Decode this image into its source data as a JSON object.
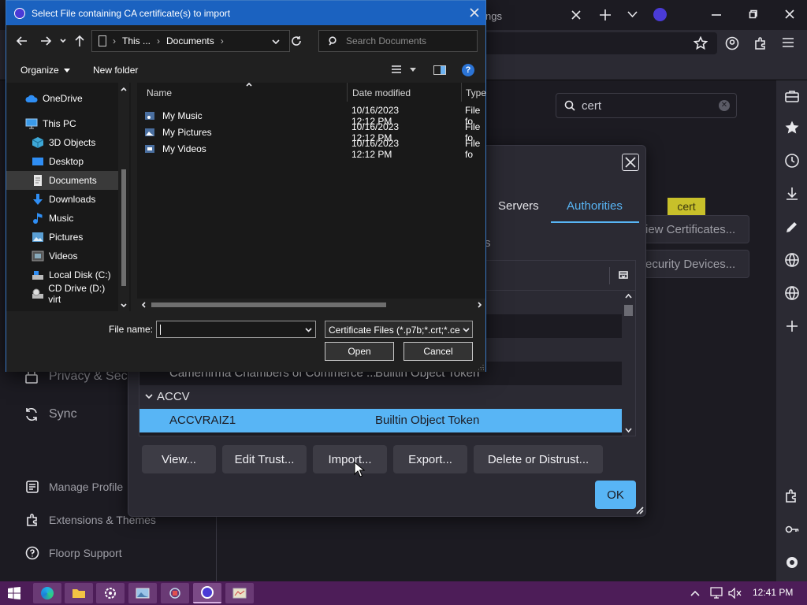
{
  "browser": {
    "tab_fragment": "ngs",
    "settings_nav": [
      {
        "label": "Privacy & Secu",
        "icon": "lock-icon"
      },
      {
        "label": "Sync",
        "icon": "sync-icon"
      }
    ],
    "settings_footer": [
      {
        "label": "Manage Profile",
        "icon": "profile-icon"
      },
      {
        "label": "Extensions & Themes",
        "icon": "puzzle-icon"
      },
      {
        "label": "Floorp Support",
        "icon": "help-icon"
      }
    ],
    "search_value": "cert",
    "highlight_tooltip": "cert",
    "view_certificates_button": "View Certificates...",
    "view_certificates_visible": "iew Certificates...",
    "security_devices_visible": "ecurity Devices..."
  },
  "cert_manager": {
    "tabs": [
      "Servers",
      "Authorities"
    ],
    "active_tab": "Authorities",
    "label_fragment": "s",
    "rows": [
      {
        "type": "item",
        "name": "Camerfirma Chambers of Commerce ...",
        "token": "Builtin Object Token"
      },
      {
        "type": "group",
        "name": "ACCV"
      },
      {
        "type": "item",
        "name": "ACCVRAIZ1",
        "token": "Builtin Object Token",
        "selected": true
      }
    ],
    "buttons": [
      "View...",
      "Edit Trust...",
      "Import...",
      "Export...",
      "Delete or Distrust..."
    ],
    "ok_label": "OK"
  },
  "file_dialog": {
    "title": "Select File containing CA certificate(s) to import",
    "address": {
      "segments": [
        "This ...",
        "Documents"
      ]
    },
    "search_placeholder": "Search Documents",
    "toolbar": {
      "organize": "Organize",
      "new_folder": "New folder"
    },
    "nav_items": [
      {
        "label": "OneDrive",
        "icon": "cloud-icon",
        "indent": 1
      },
      {
        "label": "This PC",
        "icon": "computer-icon",
        "indent": 1
      },
      {
        "label": "3D Objects",
        "icon": "cube-icon",
        "indent": 2
      },
      {
        "label": "Desktop",
        "icon": "desktop-folder-icon",
        "indent": 2
      },
      {
        "label": "Documents",
        "icon": "documents-icon",
        "indent": 2,
        "selected": true
      },
      {
        "label": "Downloads",
        "icon": "download-arrow-icon",
        "indent": 2
      },
      {
        "label": "Music",
        "icon": "music-note-icon",
        "indent": 2
      },
      {
        "label": "Pictures",
        "icon": "pictures-icon",
        "indent": 2
      },
      {
        "label": "Videos",
        "icon": "video-icon",
        "indent": 2
      },
      {
        "label": "Local Disk (C:)",
        "icon": "drive-icon",
        "indent": 2
      },
      {
        "label": "CD Drive (D:) virt",
        "icon": "cd-drive-icon",
        "indent": 2
      }
    ],
    "columns": {
      "name": "Name",
      "date": "Date modified",
      "type": "Type"
    },
    "files": [
      {
        "name": "My Music",
        "date": "10/16/2023 12:12 PM",
        "type": "File fo"
      },
      {
        "name": "My Pictures",
        "date": "10/16/2023 12:12 PM",
        "type": "File fo"
      },
      {
        "name": "My Videos",
        "date": "10/16/2023 12:12 PM",
        "type": "File fo"
      }
    ],
    "file_name_label": "File name:",
    "file_name_value": "",
    "filter": "Certificate Files (*.p7b;*.crt;*.ce",
    "open_label": "Open",
    "cancel_label": "Cancel"
  },
  "taskbar": {
    "time": "12:41 PM"
  }
}
